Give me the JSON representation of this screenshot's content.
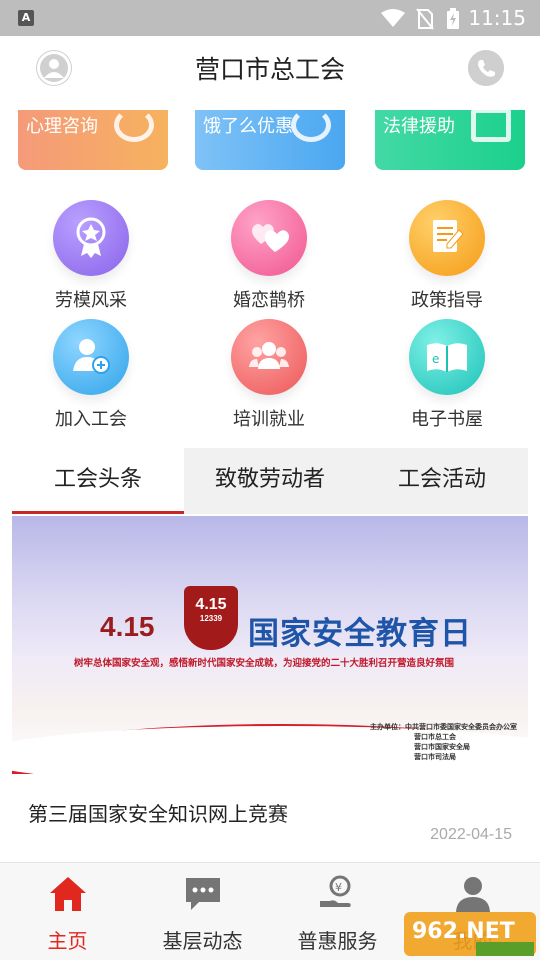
{
  "status_bar": {
    "time": "11:15",
    "app_badge": "A"
  },
  "header": {
    "title": "营口市总工会"
  },
  "banner_cards": [
    {
      "label": "心理咨询"
    },
    {
      "label": "饿了么优惠"
    },
    {
      "label": "法律援助"
    }
  ],
  "grid": [
    {
      "label": "劳模风采",
      "icon": "medal-icon",
      "color": "#9b7cf0"
    },
    {
      "label": "婚恋鹊桥",
      "icon": "hearts-icon",
      "color": "#f56fa6"
    },
    {
      "label": "政策指导",
      "icon": "document-pen-icon",
      "color": "#f8a823"
    },
    {
      "label": "加入工会",
      "icon": "add-user-icon",
      "color": "#3fb2ef"
    },
    {
      "label": "培训就业",
      "icon": "group-icon",
      "color": "#f06a6a"
    },
    {
      "label": "电子书屋",
      "icon": "ebook-icon",
      "color": "#2fcfc5"
    }
  ],
  "tabs": [
    {
      "label": "工会头条",
      "active": true
    },
    {
      "label": "致敬劳动者",
      "active": false
    },
    {
      "label": "工会活动",
      "active": false
    }
  ],
  "news": {
    "banner": {
      "date": "4.15",
      "shield_text": "4.15",
      "shield_sub": "12339",
      "headline": "国家安全教育日",
      "slogan": "树牢总体国家安全观，感悟新时代国家安全成就，为迎接党的二十大胜利召开营造良好氛围",
      "organizers": [
        "主办单位：中共营口市委国家安全委员会办公室",
        "营口市总工会",
        "营口市国家安全局",
        "营口市司法局"
      ]
    },
    "title": "第三届国家安全知识网上竞赛",
    "date": "2022-04-15"
  },
  "bottom_nav": [
    {
      "label": "主页",
      "icon": "home-icon",
      "active": true
    },
    {
      "label": "基层动态",
      "icon": "chat-bubble-icon",
      "active": false
    },
    {
      "label": "普惠服务",
      "icon": "hand-coin-icon",
      "active": false
    },
    {
      "label": "我的",
      "icon": "person-icon",
      "active": false
    }
  ],
  "colors": {
    "accent": "#e0281f",
    "tab_underline": "#c62828",
    "status_bar": "#bdbdbd"
  }
}
